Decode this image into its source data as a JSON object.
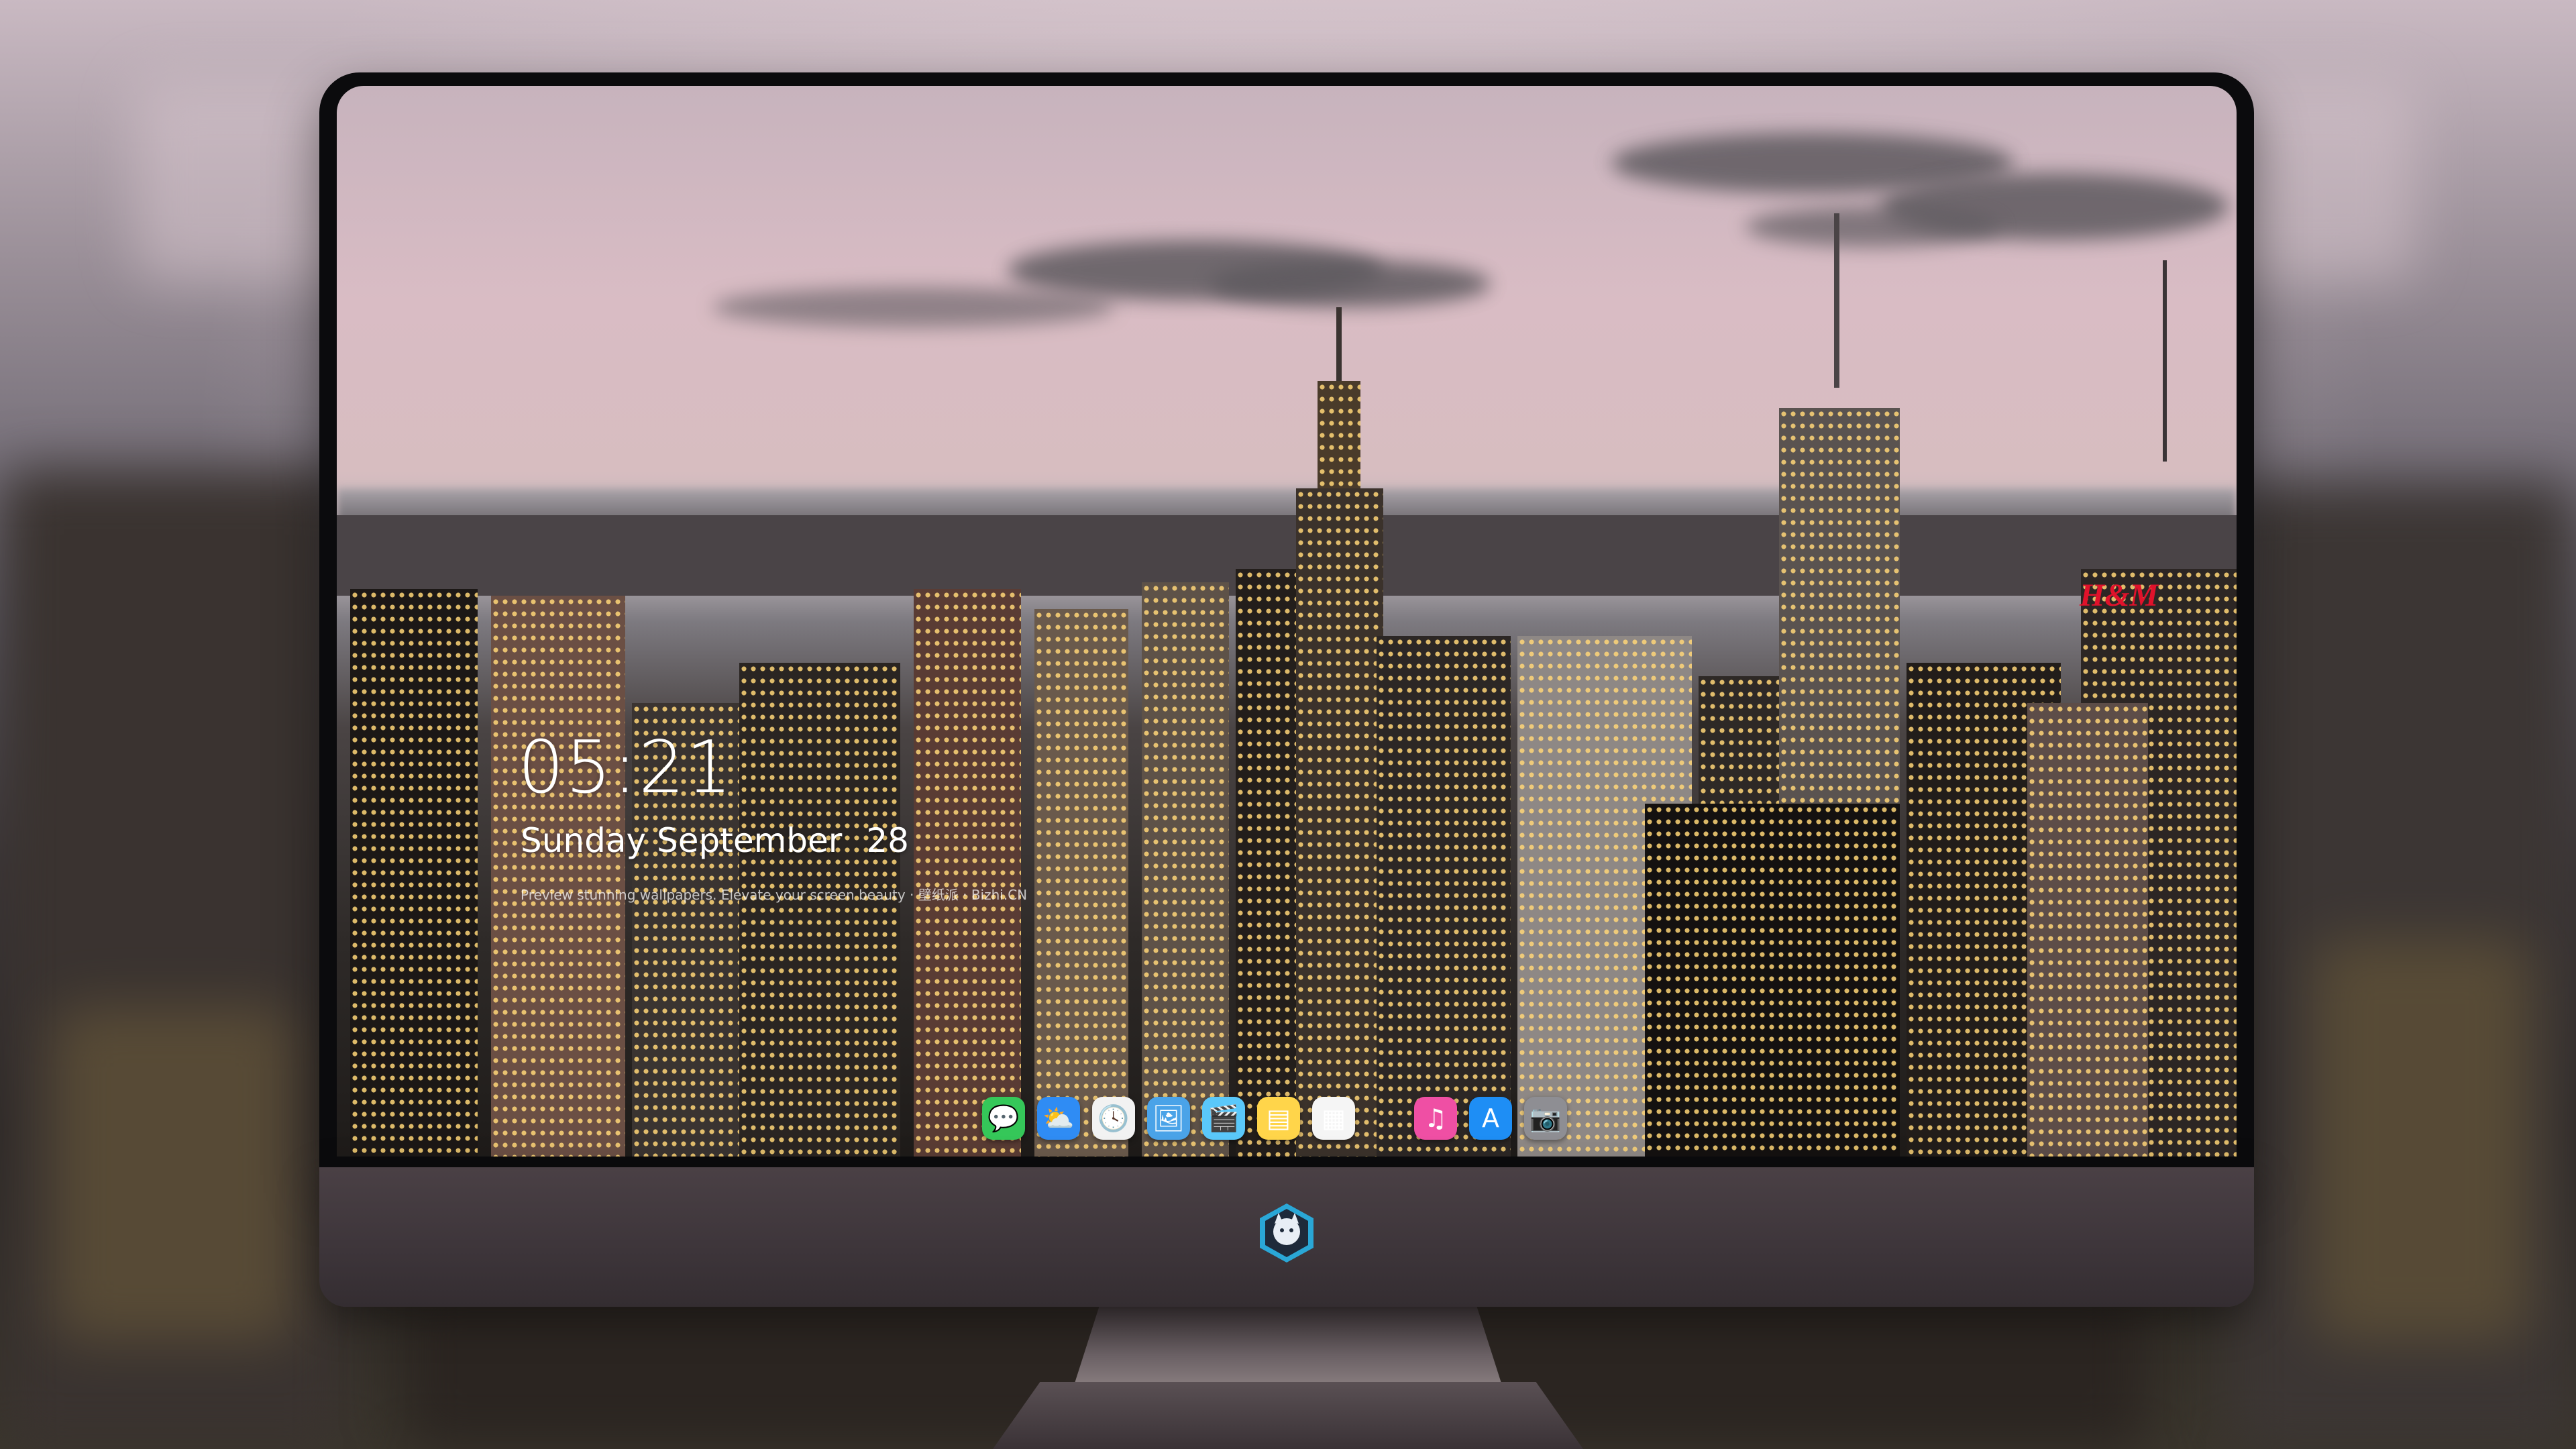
{
  "lock_screen": {
    "time": "05:21",
    "date_text": "Sunday September",
    "day_number": "28",
    "tagline": "Preview stunning wallpapers. Elevate your screen beauty · 壁纸派 · Bizhi.CN"
  },
  "wallpaper": {
    "sign_text": "H&M"
  },
  "dock": {
    "apps": [
      {
        "name": "messages-icon",
        "glyph": "💬",
        "color": "#35c759"
      },
      {
        "name": "weather-icon",
        "glyph": "⛅",
        "color": "#2f8cf4"
      },
      {
        "name": "clock-icon",
        "glyph": "🕓",
        "color": "#f2f2f2"
      },
      {
        "name": "preview-icon",
        "glyph": "🖼",
        "color": "#4aa3e8"
      },
      {
        "name": "clips-icon",
        "glyph": "🎬",
        "color": "#5ac8fa"
      },
      {
        "name": "notes-icon",
        "glyph": "▤",
        "color": "#ffd54a"
      },
      {
        "name": "photos-icon",
        "glyph": "▦",
        "color": "#f5f5f5"
      },
      {
        "name": "music-icon",
        "glyph": "♫",
        "color": "#ef4fa4"
      },
      {
        "name": "app-store-icon",
        "glyph": "A",
        "color": "#1e8ef5"
      },
      {
        "name": "camera-icon",
        "glyph": "📷",
        "color": "#8e8e93"
      }
    ]
  },
  "colors": {
    "screen_bezel": "#0b0b0d",
    "chin": "#3d353a",
    "sign_red": "#e0122b"
  }
}
